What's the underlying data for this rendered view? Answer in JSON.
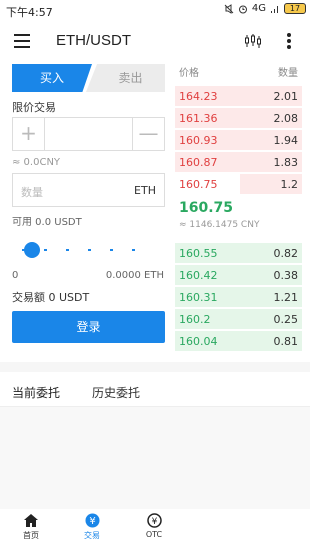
{
  "status_bar": {
    "time": "下午4:57",
    "network": "4G",
    "battery": "17"
  },
  "header": {
    "pair": "ETH/USDT"
  },
  "tabs": {
    "buy": "买入",
    "sell": "卖出"
  },
  "form": {
    "order_type": "限价交易",
    "price_plus": "+",
    "price_minus": "—",
    "cny_value": "≈ 0.0CNY",
    "amount_placeholder": "数量",
    "amount_unit": "ETH",
    "available": "可用 0.0 USDT",
    "slider_min": "0",
    "slider_max": "0.0000 ETH",
    "total": "交易额 0 USDT",
    "submit_label": "登录"
  },
  "order_book": {
    "price_header": "价格",
    "qty_header": "数量",
    "asks": [
      {
        "price": "164.23",
        "qty": "2.01"
      },
      {
        "price": "161.36",
        "qty": "2.08"
      },
      {
        "price": "160.93",
        "qty": "1.94"
      },
      {
        "price": "160.87",
        "qty": "1.83"
      },
      {
        "price": "160.75",
        "qty": "1.2"
      }
    ],
    "last_price": "160.75",
    "last_price_cny": "≈ 1146.1475 CNY",
    "bids": [
      {
        "price": "160.55",
        "qty": "0.82"
      },
      {
        "price": "160.42",
        "qty": "0.38"
      },
      {
        "price": "160.31",
        "qty": "1.21"
      },
      {
        "price": "160.2",
        "qty": "0.25"
      },
      {
        "price": "160.04",
        "qty": "0.81"
      }
    ]
  },
  "orders_tabs": {
    "current": "当前委托",
    "history": "历史委托"
  },
  "nav": {
    "home": "首页",
    "trade": "交易",
    "otc": "OTC"
  },
  "colors": {
    "accent": "#1a86e8",
    "ask": "#e04040",
    "bid": "#2aa860"
  }
}
